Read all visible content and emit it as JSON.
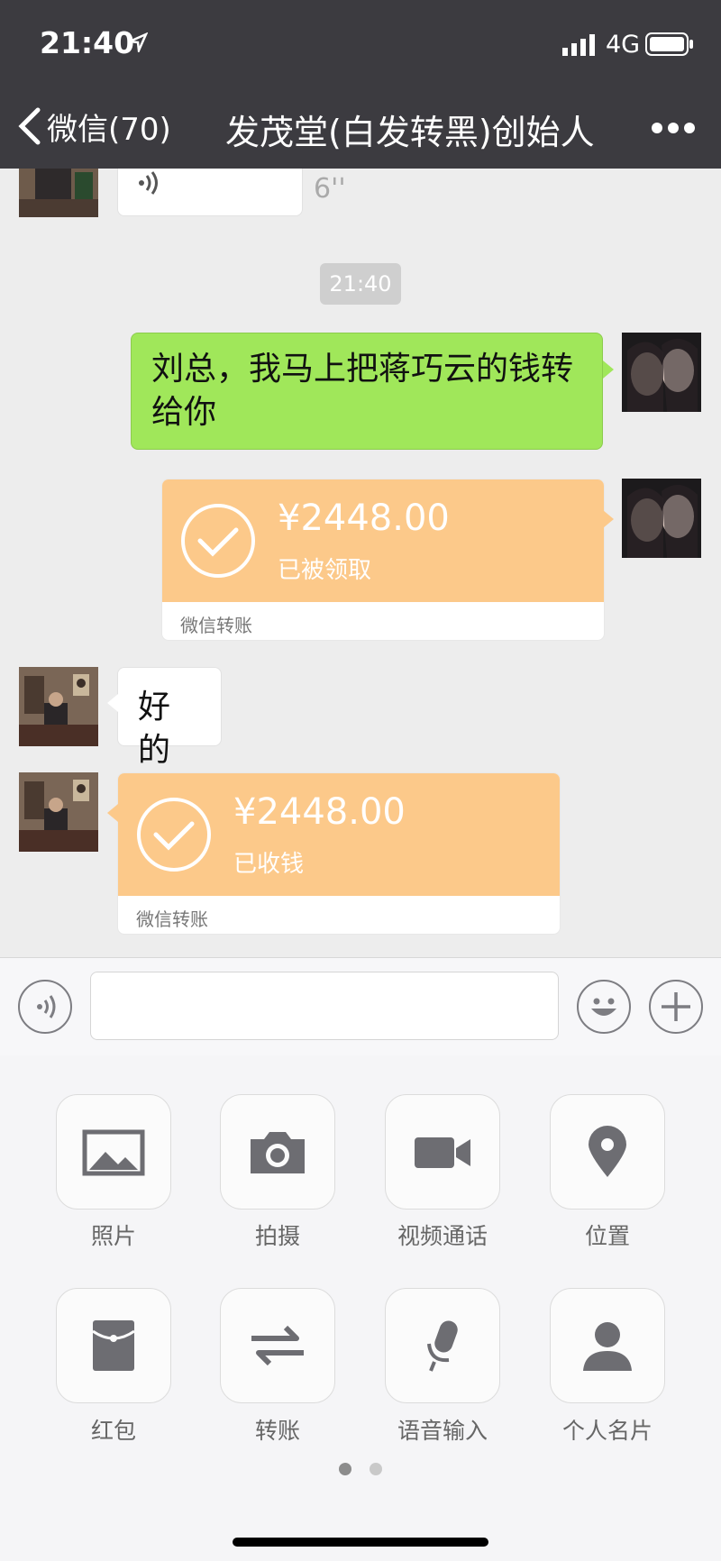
{
  "status_bar": {
    "time": "21:40",
    "network": "4G"
  },
  "nav": {
    "back_label": "微信(70)",
    "title": "发茂堂(白发转黑)创始人"
  },
  "messages": {
    "voice_duration": "6''",
    "timestamp": "21:40",
    "msg_outgoing_text": "刘总，我马上把蒋巧云的钱转给你",
    "transfer_out": {
      "amount": "¥2448.00",
      "status": "已被领取",
      "footer": "微信转账"
    },
    "msg_incoming_text": "好的",
    "transfer_in": {
      "amount": "¥2448.00",
      "status": "已收钱",
      "footer": "微信转账"
    }
  },
  "panel": {
    "items": [
      {
        "label": "照片",
        "icon": "photo-icon"
      },
      {
        "label": "拍摄",
        "icon": "camera-icon"
      },
      {
        "label": "视频通话",
        "icon": "video-call-icon"
      },
      {
        "label": "位置",
        "icon": "location-icon"
      },
      {
        "label": "红包",
        "icon": "red-packet-icon"
      },
      {
        "label": "转账",
        "icon": "transfer-icon"
      },
      {
        "label": "语音输入",
        "icon": "microphone-icon"
      },
      {
        "label": "个人名片",
        "icon": "contact-card-icon"
      }
    ],
    "page_count": 2,
    "current_page": 1
  },
  "colors": {
    "nav_bg": "#3c3b40",
    "green_bubble": "#a0e75a",
    "transfer_orange": "#fcc98a",
    "chat_bg": "#ededed"
  }
}
